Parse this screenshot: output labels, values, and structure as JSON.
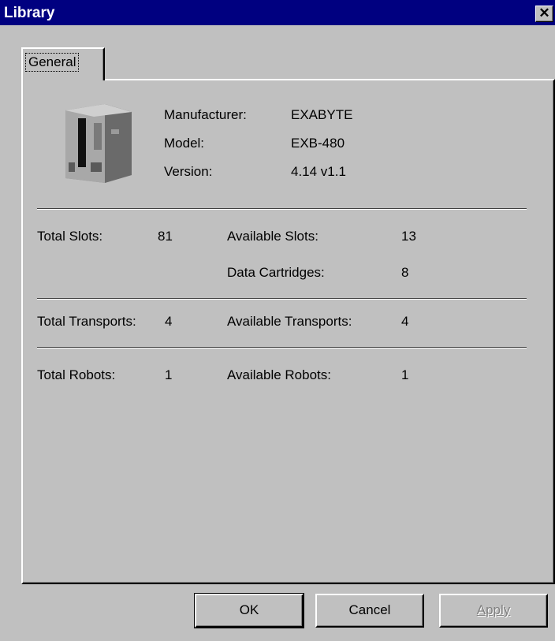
{
  "window": {
    "title": "Library",
    "close_glyph": "✕"
  },
  "tabs": [
    {
      "label": "General",
      "selected": true
    }
  ],
  "device": {
    "icon": "tape-library-icon",
    "manufacturer_label": "Manufacturer:",
    "manufacturer_value": "EXABYTE",
    "model_label": "Model:",
    "model_value": "EXB-480",
    "version_label": "Version:",
    "version_value": "4.14 v1.1"
  },
  "slots": {
    "total_label": "Total Slots:",
    "total_value": "81",
    "available_label": "Available Slots:",
    "available_value": "13",
    "cartridges_label": "Data Cartridges:",
    "cartridges_value": "8"
  },
  "transports": {
    "total_label": "Total Transports:",
    "total_value": "4",
    "available_label": "Available Transports:",
    "available_value": "4"
  },
  "robots": {
    "total_label": "Total Robots:",
    "total_value": "1",
    "available_label": "Available Robots:",
    "available_value": "1"
  },
  "buttons": {
    "ok": "OK",
    "cancel": "Cancel",
    "apply": "Apply",
    "apply_enabled": false
  },
  "colors": {
    "title_bar": "#000080",
    "face": "#c0c0c0"
  }
}
